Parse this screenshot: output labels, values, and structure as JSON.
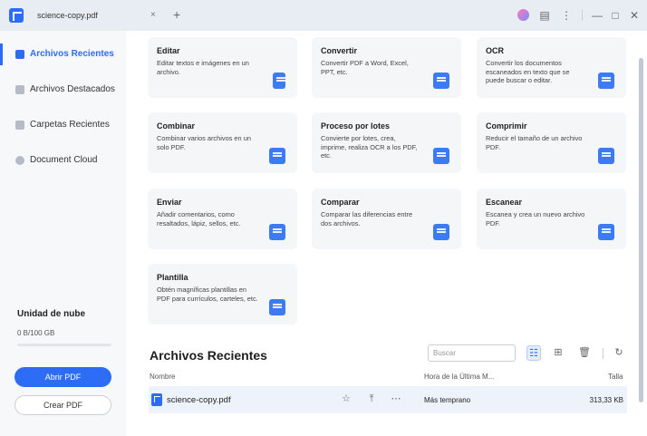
{
  "titlebar": {
    "tab_label": "science-copy.pdf",
    "close_glyph": "×",
    "add_glyph": "+",
    "icons": [
      "avatar-icon",
      "feedback-icon",
      "more-icon",
      "minimize-icon",
      "maximize-icon",
      "close-icon"
    ],
    "feedback_glyph": "▤",
    "more_glyph": "⋮",
    "minimize_glyph": "—",
    "maximize_glyph": "□",
    "window_close_glyph": "✕"
  },
  "sidebar": {
    "items": [
      {
        "label": "Archivos Recientes",
        "icon": "recent-files-icon",
        "active": true
      },
      {
        "label": "Archivos Destacados",
        "icon": "starred-icon",
        "active": false
      },
      {
        "label": "Carpetas Recientes",
        "icon": "folder-icon",
        "active": false
      },
      {
        "label": "Document Cloud",
        "icon": "cloud-icon",
        "active": false
      }
    ],
    "cloud": {
      "title": "Unidad de nube",
      "usage": "0 B/100 GB",
      "usage_fraction": 0
    },
    "open_button": "Abrir PDF",
    "create_button": "Crear PDF"
  },
  "tools": [
    {
      "title": "Editar",
      "desc": "Editar textos e imágenes en un archivo.",
      "icon": "edit-icon"
    },
    {
      "title": "Convertir",
      "desc": "Convertir PDF a Word, Excel, PPT, etc.",
      "icon": "convert-icon"
    },
    {
      "title": "OCR",
      "desc": "Convertir los documentos escaneados en texto que se puede buscar o editar.",
      "icon": "ocr-icon"
    },
    {
      "title": "Combinar",
      "desc": "Combinar varios archivos en un solo PDF.",
      "icon": "combine-icon"
    },
    {
      "title": "Proceso por lotes",
      "desc": "Convierte por lotes, crea, imprime, realiza OCR a los PDF, etc.",
      "icon": "batch-icon"
    },
    {
      "title": "Comprimir",
      "desc": "Reducir el tamaño de un archivo PDF.",
      "icon": "compress-icon"
    },
    {
      "title": "Enviar",
      "desc": "Añadir comentarios, como resaltados, lápiz, sellos, etc.",
      "icon": "send-icon"
    },
    {
      "title": "Comparar",
      "desc": "Comparar las diferencias entre dos archivos.",
      "icon": "compare-icon"
    },
    {
      "title": "Escanear",
      "desc": "Escanea y crea un nuevo archivo PDF.",
      "icon": "scan-icon"
    },
    {
      "title": "Plantilla",
      "desc": "Obtén magníficas plantillas en PDF para currículos, carteles, etc.",
      "icon": "template-icon"
    }
  ],
  "recent": {
    "title": "Archivos Recientes",
    "search_placeholder": "Buscar",
    "columns": {
      "name": "Nombre",
      "time": "Hora de la Última M...",
      "size": "Talla"
    },
    "view_icons": [
      "list-view-icon",
      "grid-view-icon",
      "delete-icon",
      "refresh-icon"
    ],
    "list_glyph": "☷",
    "grid_glyph": "⊞",
    "delete_glyph": "🗑",
    "refresh_glyph": "↻",
    "files": [
      {
        "name": "science-copy.pdf",
        "time": "Más temprano",
        "size": "313,33 KB",
        "star_glyph": "☆",
        "upload_glyph": "⤒",
        "more_glyph": "⋯"
      }
    ]
  },
  "colors": {
    "accent": "#2d6cf5",
    "sidebar_bg": "#f7f8fa",
    "card_bg": "#f5f6f8",
    "icon_blue": "#3b7bf6"
  }
}
